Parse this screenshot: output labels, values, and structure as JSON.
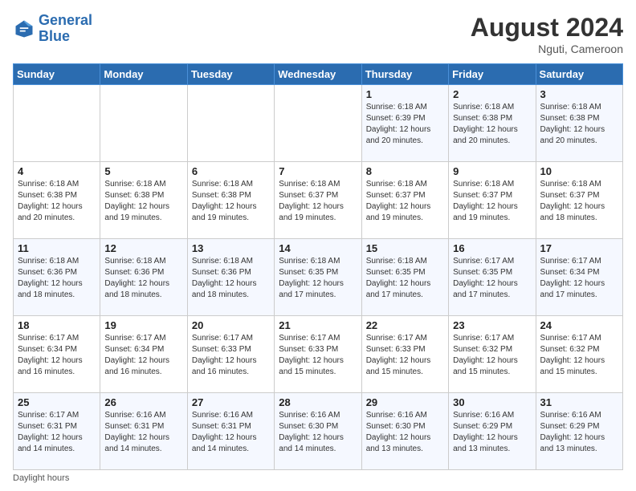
{
  "header": {
    "logo_line1": "General",
    "logo_line2": "Blue",
    "month_year": "August 2024",
    "location": "Nguti, Cameroon"
  },
  "footer": {
    "label": "Daylight hours"
  },
  "columns": [
    "Sunday",
    "Monday",
    "Tuesday",
    "Wednesday",
    "Thursday",
    "Friday",
    "Saturday"
  ],
  "weeks": [
    [
      {
        "day": "",
        "content": ""
      },
      {
        "day": "",
        "content": ""
      },
      {
        "day": "",
        "content": ""
      },
      {
        "day": "",
        "content": ""
      },
      {
        "day": "1",
        "content": "Sunrise: 6:18 AM\nSunset: 6:39 PM\nDaylight: 12 hours\nand 20 minutes."
      },
      {
        "day": "2",
        "content": "Sunrise: 6:18 AM\nSunset: 6:38 PM\nDaylight: 12 hours\nand 20 minutes."
      },
      {
        "day": "3",
        "content": "Sunrise: 6:18 AM\nSunset: 6:38 PM\nDaylight: 12 hours\nand 20 minutes."
      }
    ],
    [
      {
        "day": "4",
        "content": "Sunrise: 6:18 AM\nSunset: 6:38 PM\nDaylight: 12 hours\nand 20 minutes."
      },
      {
        "day": "5",
        "content": "Sunrise: 6:18 AM\nSunset: 6:38 PM\nDaylight: 12 hours\nand 19 minutes."
      },
      {
        "day": "6",
        "content": "Sunrise: 6:18 AM\nSunset: 6:38 PM\nDaylight: 12 hours\nand 19 minutes."
      },
      {
        "day": "7",
        "content": "Sunrise: 6:18 AM\nSunset: 6:37 PM\nDaylight: 12 hours\nand 19 minutes."
      },
      {
        "day": "8",
        "content": "Sunrise: 6:18 AM\nSunset: 6:37 PM\nDaylight: 12 hours\nand 19 minutes."
      },
      {
        "day": "9",
        "content": "Sunrise: 6:18 AM\nSunset: 6:37 PM\nDaylight: 12 hours\nand 19 minutes."
      },
      {
        "day": "10",
        "content": "Sunrise: 6:18 AM\nSunset: 6:37 PM\nDaylight: 12 hours\nand 18 minutes."
      }
    ],
    [
      {
        "day": "11",
        "content": "Sunrise: 6:18 AM\nSunset: 6:36 PM\nDaylight: 12 hours\nand 18 minutes."
      },
      {
        "day": "12",
        "content": "Sunrise: 6:18 AM\nSunset: 6:36 PM\nDaylight: 12 hours\nand 18 minutes."
      },
      {
        "day": "13",
        "content": "Sunrise: 6:18 AM\nSunset: 6:36 PM\nDaylight: 12 hours\nand 18 minutes."
      },
      {
        "day": "14",
        "content": "Sunrise: 6:18 AM\nSunset: 6:35 PM\nDaylight: 12 hours\nand 17 minutes."
      },
      {
        "day": "15",
        "content": "Sunrise: 6:18 AM\nSunset: 6:35 PM\nDaylight: 12 hours\nand 17 minutes."
      },
      {
        "day": "16",
        "content": "Sunrise: 6:17 AM\nSunset: 6:35 PM\nDaylight: 12 hours\nand 17 minutes."
      },
      {
        "day": "17",
        "content": "Sunrise: 6:17 AM\nSunset: 6:34 PM\nDaylight: 12 hours\nand 17 minutes."
      }
    ],
    [
      {
        "day": "18",
        "content": "Sunrise: 6:17 AM\nSunset: 6:34 PM\nDaylight: 12 hours\nand 16 minutes."
      },
      {
        "day": "19",
        "content": "Sunrise: 6:17 AM\nSunset: 6:34 PM\nDaylight: 12 hours\nand 16 minutes."
      },
      {
        "day": "20",
        "content": "Sunrise: 6:17 AM\nSunset: 6:33 PM\nDaylight: 12 hours\nand 16 minutes."
      },
      {
        "day": "21",
        "content": "Sunrise: 6:17 AM\nSunset: 6:33 PM\nDaylight: 12 hours\nand 15 minutes."
      },
      {
        "day": "22",
        "content": "Sunrise: 6:17 AM\nSunset: 6:33 PM\nDaylight: 12 hours\nand 15 minutes."
      },
      {
        "day": "23",
        "content": "Sunrise: 6:17 AM\nSunset: 6:32 PM\nDaylight: 12 hours\nand 15 minutes."
      },
      {
        "day": "24",
        "content": "Sunrise: 6:17 AM\nSunset: 6:32 PM\nDaylight: 12 hours\nand 15 minutes."
      }
    ],
    [
      {
        "day": "25",
        "content": "Sunrise: 6:17 AM\nSunset: 6:31 PM\nDaylight: 12 hours\nand 14 minutes."
      },
      {
        "day": "26",
        "content": "Sunrise: 6:16 AM\nSunset: 6:31 PM\nDaylight: 12 hours\nand 14 minutes."
      },
      {
        "day": "27",
        "content": "Sunrise: 6:16 AM\nSunset: 6:31 PM\nDaylight: 12 hours\nand 14 minutes."
      },
      {
        "day": "28",
        "content": "Sunrise: 6:16 AM\nSunset: 6:30 PM\nDaylight: 12 hours\nand 14 minutes."
      },
      {
        "day": "29",
        "content": "Sunrise: 6:16 AM\nSunset: 6:30 PM\nDaylight: 12 hours\nand 13 minutes."
      },
      {
        "day": "30",
        "content": "Sunrise: 6:16 AM\nSunset: 6:29 PM\nDaylight: 12 hours\nand 13 minutes."
      },
      {
        "day": "31",
        "content": "Sunrise: 6:16 AM\nSunset: 6:29 PM\nDaylight: 12 hours\nand 13 minutes."
      }
    ]
  ]
}
